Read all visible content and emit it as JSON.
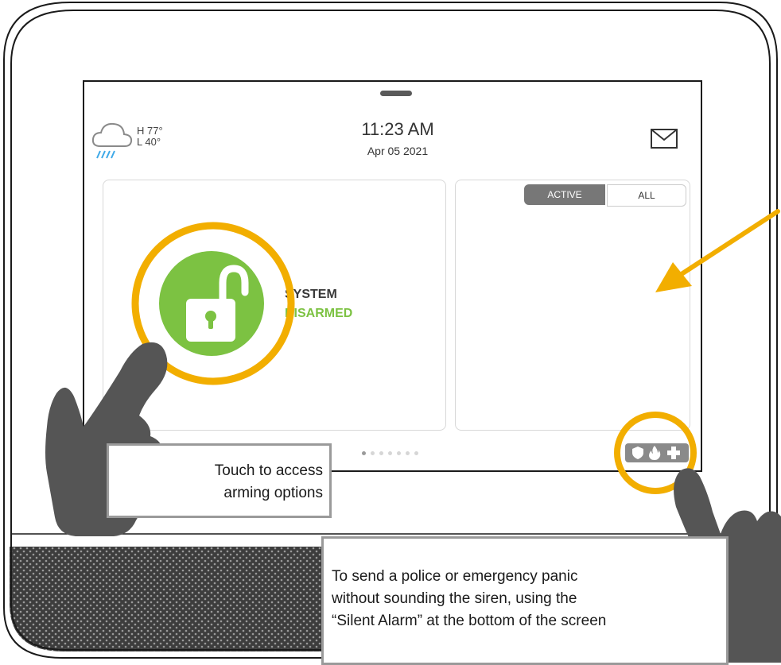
{
  "header": {
    "weather": {
      "icon": "rain-cloud-icon",
      "high": "H 77°",
      "low": "L 40°"
    },
    "time": "11:23 AM",
    "date": "Apr 05 2021",
    "messages_icon": "envelope-icon"
  },
  "security": {
    "status_line1": "SYSTEM",
    "status_line2": "DISARMED",
    "lock_icon": "unlocked-padlock-icon"
  },
  "events": {
    "tabs": [
      {
        "label": "ACTIVE",
        "selected": true
      },
      {
        "label": "ALL",
        "selected": false
      }
    ]
  },
  "pager": {
    "pages": 7,
    "current": 1
  },
  "panic": {
    "icons": [
      "shield-icon",
      "fire-icon",
      "medical-cross-icon"
    ]
  },
  "callouts": {
    "arming_line1": "Touch to access",
    "arming_line2": "arming options",
    "silent_line1": "To send a police or emergency panic",
    "silent_line2": "without sounding the siren, using the",
    "silent_line3": "“Silent Alarm” at the bottom of the screen"
  },
  "colors": {
    "highlight_ring": "#f2ae00",
    "disarmed_green": "#7cc242",
    "hand": "#555555",
    "panic_bg": "#8a8a8a"
  }
}
